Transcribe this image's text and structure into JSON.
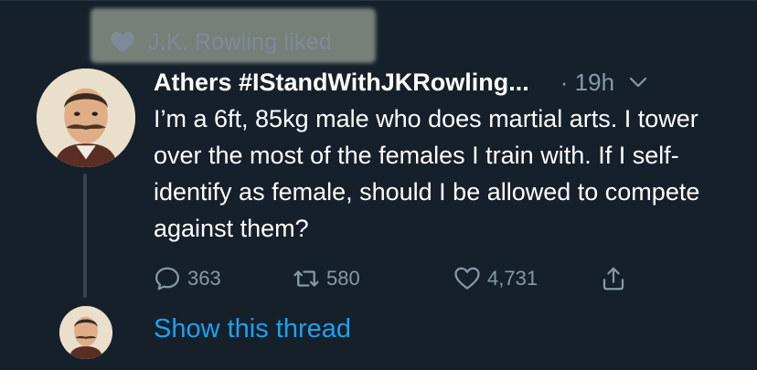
{
  "liked_banner": {
    "text": "J.K. Rowling liked",
    "icon": "heart-filled-icon"
  },
  "tweet": {
    "author_name": "Athers #IStandWithJKRowling...",
    "time": "· 19h",
    "text": "I’m a 6ft, 85kg male who does martial arts. I tower over the most of the females I train with. If I self-identify as female, should I be allowed to compete against them?",
    "stats": {
      "replies": "363",
      "retweets": "580",
      "likes": "4,731"
    }
  },
  "thread": {
    "show_label": "Show this thread"
  },
  "colors": {
    "background": "#15202b",
    "secondary_text": "#8899a6",
    "link": "#1da1f2",
    "highlight": "#c8d0b8"
  }
}
